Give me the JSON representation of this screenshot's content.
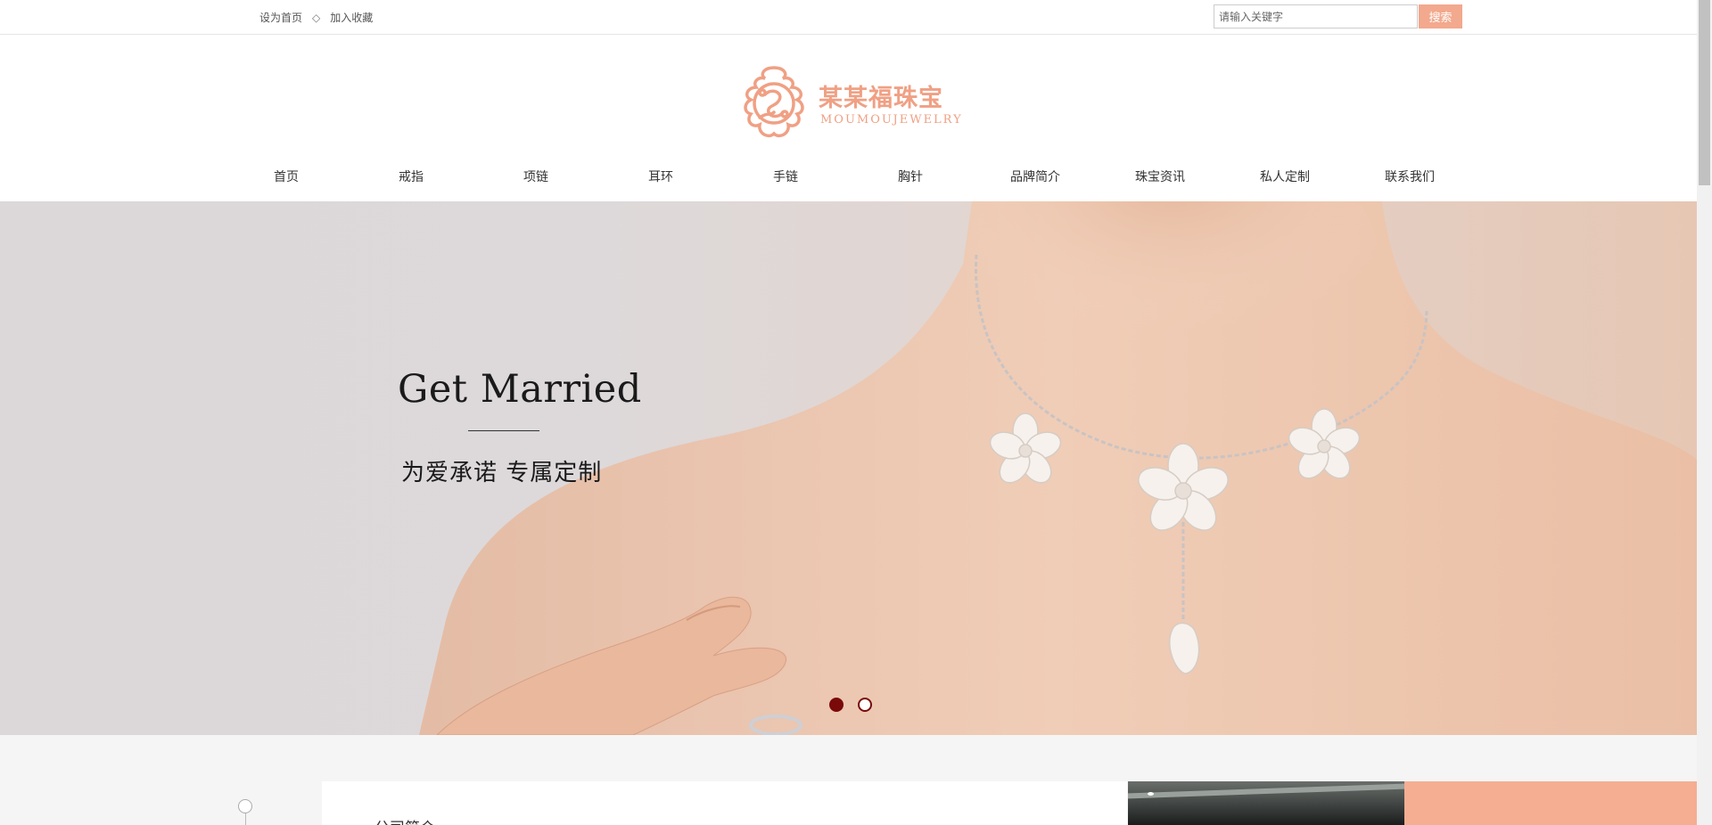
{
  "topbar": {
    "set_home": "设为首页",
    "separator": "◇",
    "add_favorite": "加入收藏",
    "search_placeholder": "请输入关键字",
    "search_button": "搜索"
  },
  "logo": {
    "name_cn": "某某福珠宝",
    "name_en": "MOUMOUJEWELRY",
    "color": "#f0a084"
  },
  "nav": {
    "items": [
      "首页",
      "戒指",
      "项链",
      "耳环",
      "手链",
      "胸针",
      "品牌简介",
      "珠宝资讯",
      "私人定制",
      "联系我们"
    ]
  },
  "banner": {
    "headline": "Get Married",
    "subtitle": "为爱承诺 专属定制",
    "slide_count": 2,
    "active_slide": 1,
    "dot_color": "#7a0a0a"
  },
  "intro": {
    "title": "公司简介"
  },
  "colors": {
    "accent": "#f2a98e",
    "peach_panel": "#f5ae92"
  }
}
